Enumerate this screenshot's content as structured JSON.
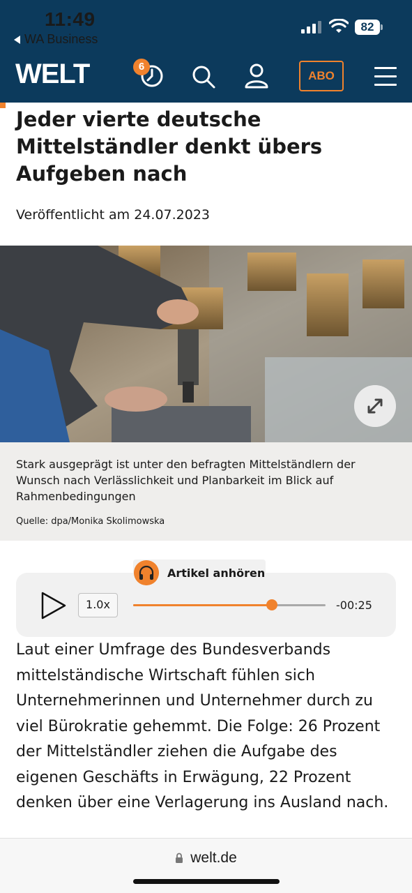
{
  "status_bar": {
    "time": "11:49",
    "back_app": "WA Business",
    "battery": "82"
  },
  "header": {
    "logo": "WELT",
    "history_badge": "6",
    "abo_label": "ABO",
    "icons": [
      "history-icon",
      "search-icon",
      "account-icon",
      "menu-icon"
    ]
  },
  "article": {
    "headline": "Jeder vierte deutsche Mittelständler denkt übers Aufgeben nach",
    "published": "Veröffentlicht am 24.07.2023",
    "image_caption": "Stark ausgeprägt ist unter den befragten Mittelständlern der Wunsch nach Verlässlichkeit und Planbarkeit im Blick auf Rahmenbedingungen",
    "image_source": "Quelle: dpa/Monika Skolimowska",
    "body": "Laut einer Umfrage des Bundesverbands mittelständische Wirtschaft fühlen sich Unternehmerinnen und Unternehmer durch zu viel Bürokratie gehemmt. Die Folge: 26 Prozent der Mittelständler ziehen die Aufgabe des eigenen Geschäfts in Erwägung, 22 Prozent denken über eine Verlagerung ins Ausland nach."
  },
  "audio_player": {
    "label": "Artikel anhören",
    "speed": "1.0x",
    "time_remaining": "-00:25",
    "progress_fraction": 0.72
  },
  "browser": {
    "url": "welt.de"
  },
  "colors": {
    "brand_navy": "#0c3a5c",
    "accent_orange": "#f0822d"
  }
}
